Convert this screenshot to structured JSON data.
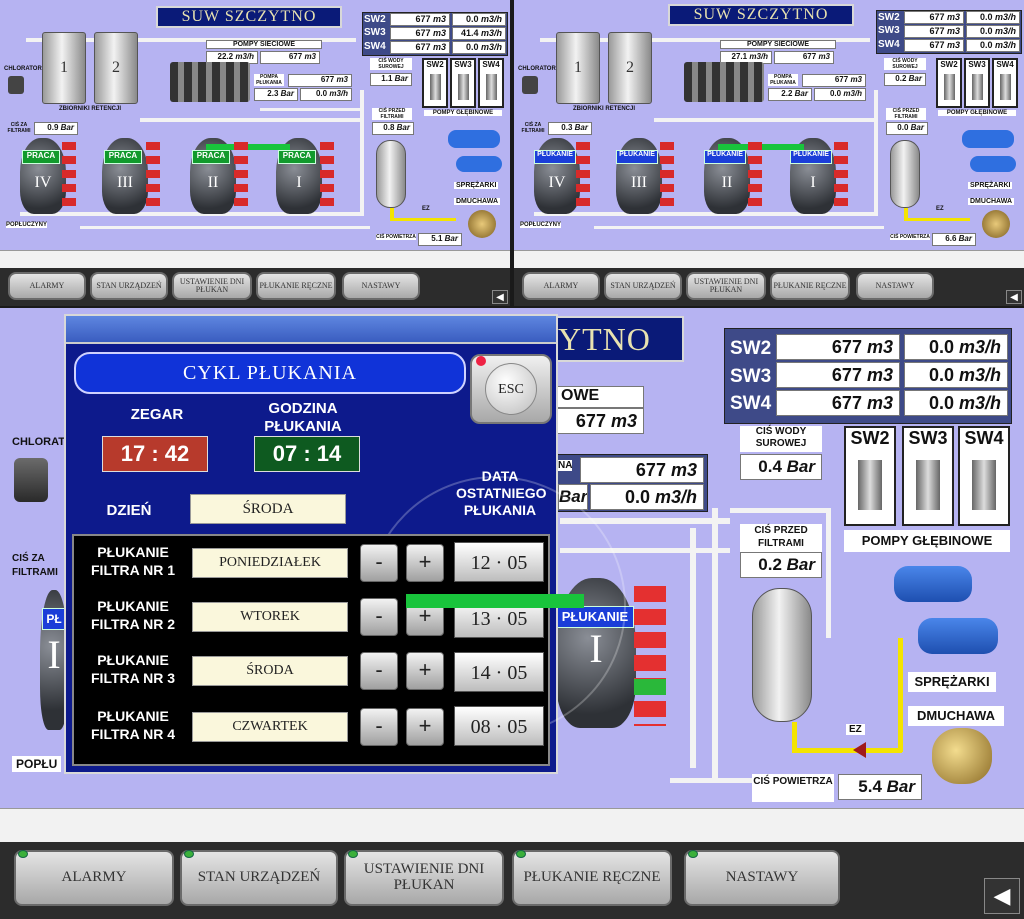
{
  "top_left": {
    "title": "SUW SZCZYTNO",
    "sw": [
      {
        "label": "SW2",
        "vol": "677",
        "vol_unit": "m3",
        "flow": "0.0",
        "flow_unit": "m3/h"
      },
      {
        "label": "SW3",
        "vol": "677",
        "vol_unit": "m3",
        "flow": "41.4",
        "flow_unit": "m3/h"
      },
      {
        "label": "SW4",
        "vol": "677",
        "vol_unit": "m3",
        "flow": "0.0",
        "flow_unit": "m3/h"
      }
    ],
    "pompy_sieciowe_label": "POMPY SIECIOWE",
    "pompy_flow": "22.2",
    "pompy_flow_unit": "m3/h",
    "pompy_vol": "677",
    "pompy_vol_unit": "m3",
    "pompa_plukania_label": "POMPA PŁUKANIA",
    "pompa_plukania_vol": "677",
    "pompa_plukania_vol_unit": "m3",
    "pompa_plukania_pressure": "2.3",
    "pompa_plukania_pressure_unit": "Bar",
    "pompa_plukania_flow": "0.0",
    "pompa_plukania_flow_unit": "m3/h",
    "cisn_wody_label": "CIŚ WODY SUROWEJ",
    "cisn_wody": "1.1",
    "cisn_wody_unit": "Bar",
    "chlorator": "CHLORATOR",
    "zbiorniki": "ZBIORNIKI RETENCJI",
    "tank1": "1",
    "tank2": "2",
    "cis_za_filtr_label": "CIŚ ZA FILTRAMI",
    "cis_za_filtr": "0.9",
    "cis_za_filtr_unit": "Bar",
    "cis_przed_label": "CIŚ PRZED FILTRAMI",
    "cis_przed": "0.8",
    "cis_przed_unit": "Bar",
    "filters": [
      "IV",
      "III",
      "II",
      "I"
    ],
    "filter_status": [
      "PRACA",
      "PRACA",
      "PRACA",
      "PRACA"
    ],
    "pompy_glebinowe": "POMPY GŁĘBINOWE",
    "sw_pumps": [
      "SW2",
      "SW3",
      "SW4"
    ],
    "sprezarki": "SPRĘŻARKI",
    "dmuchawa": "DMUCHAWA",
    "ez": "EZ",
    "poplu": "POPŁUCZYNY",
    "cis_pow_label": "CIŚ POWIETRZA",
    "cis_pow": "5.1",
    "cis_pow_unit": "Bar"
  },
  "top_right": {
    "title": "SUW SZCZYTNO",
    "sw": [
      {
        "label": "SW2",
        "vol": "677",
        "vol_unit": "m3",
        "flow": "0.0",
        "flow_unit": "m3/h"
      },
      {
        "label": "SW3",
        "vol": "677",
        "vol_unit": "m3",
        "flow": "0.0",
        "flow_unit": "m3/h"
      },
      {
        "label": "SW4",
        "vol": "677",
        "vol_unit": "m3",
        "flow": "0.0",
        "flow_unit": "m3/h"
      }
    ],
    "pompy_sieciowe_label": "POMPY SIECIOWE",
    "pompy_flow": "27.1",
    "pompy_flow_unit": "m3/h",
    "pompy_vol": "677",
    "pompy_vol_unit": "m3",
    "pompa_plukania_label": "POMPA PŁUKANIA",
    "pompa_plukania_vol": "677",
    "pompa_plukania_vol_unit": "m3",
    "pompa_plukania_pressure": "2.2",
    "pompa_plukania_pressure_unit": "Bar",
    "pompa_plukania_flow": "0.0",
    "pompa_plukania_flow_unit": "m3/h",
    "cisn_wody_label": "CIŚ WODY SUROWEJ",
    "cisn_wody": "0.2",
    "cisn_wody_unit": "Bar",
    "chlorator": "CHLORATOR",
    "zbiorniki": "ZBIORNIKI RETENCJI",
    "tank1": "1",
    "tank2": "2",
    "cis_za_filtr_label": "CIŚ ZA FILTRAMI",
    "cis_za_filtr": "0.3",
    "cis_za_filtr_unit": "Bar",
    "cis_przed_label": "CIŚ PRZED FILTRAMI",
    "cis_przed": "0.0",
    "cis_przed_unit": "Bar",
    "filters": [
      "IV",
      "III",
      "II",
      "I"
    ],
    "filter_status": [
      "PŁUKANIE",
      "PŁUKANIE",
      "PŁUKANIE",
      "PŁUKANIE"
    ],
    "pompy_glebinowe": "POMPY GŁĘBINOWE",
    "sw_pumps": [
      "SW2",
      "SW3",
      "SW4"
    ],
    "sprezarki": "SPRĘŻARKI",
    "dmuchawa": "DMUCHAWA",
    "ez": "EZ",
    "poplu": "POPŁUCZYNY",
    "cis_pow_label": "CIŚ POWIETRZA",
    "cis_pow": "6.6",
    "cis_pow_unit": "Bar"
  },
  "buttons": [
    "ALARMY",
    "STAN URZĄDZEŃ",
    "USTAWIENIE DNI PŁUKAN",
    "PŁUKANIE RĘCZNE",
    "NASTAWY"
  ],
  "return_icon": "arrow-left-icon",
  "main": {
    "title_fragment": "YTNO",
    "sw": [
      {
        "label": "SW2",
        "vol": "677",
        "vol_unit": "m3",
        "flow": "0.0",
        "flow_unit": "m3/h"
      },
      {
        "label": "SW3",
        "vol": "677",
        "vol_unit": "m3",
        "flow": "0.0",
        "flow_unit": "m3/h"
      },
      {
        "label": "SW4",
        "vol": "677",
        "vol_unit": "m3",
        "flow": "0.0",
        "flow_unit": "m3/h"
      }
    ],
    "owe_fragment": "OWE",
    "pompy_vol": "677",
    "pompy_vol_unit": "m3",
    "na_fragment": "NA",
    "pp_vol": "677",
    "pp_vol_unit": "m3",
    "bar_fragment": "Bar",
    "pp_flow": "0.0",
    "pp_flow_unit": "m3/h",
    "cisn_wody_label": "CIŚ WODY SUROWEJ",
    "cisn_wody": "0.4",
    "cisn_wody_unit": "Bar",
    "cis_przed_label": "CIŚ PRZED FILTRAMI",
    "cis_przed": "0.2",
    "cis_przed_unit": "Bar",
    "sw_pumps": [
      "SW2",
      "SW3",
      "SW4"
    ],
    "pompy_glebinowe": "POMPY GŁĘBINOWE",
    "sprezarki": "SPRĘŻARKI",
    "dmuchawa": "DMUCHAWA",
    "ez": "EZ",
    "cis_pow_label": "CIŚ POWIETRZA",
    "cis_pow": "5.4",
    "cis_pow_unit": "Bar",
    "chlorator_fragment": "CHLORAT",
    "cis_za_fragment": "CIŚ ZA FILTRAMI",
    "poplu_fragment": "POPŁU",
    "filter_label": "I",
    "filter_label_left": "I",
    "filter_status": "PŁUKANIE",
    "filter_status_left_fragment": "PŁ"
  },
  "popup": {
    "title": "CYKL PŁUKANIA",
    "esc": "ESC",
    "zegar_label": "ZEGAR",
    "godzina_label": "GODZINA PŁUKANIA",
    "zegar_time": "17 : 42",
    "godzina_time": "07 : 14",
    "dzien_label": "DZIEŃ",
    "dzien_value": "ŚRODA",
    "data_label": "DATA OSTATNIEGO PŁUKANIA",
    "filters": [
      {
        "label": "PŁUKANIE FILTRA NR 1",
        "day": "PONIEDZIAŁEK",
        "date": "12 · 05"
      },
      {
        "label": "PŁUKANIE FILTRA NR 2",
        "day": "WTOREK",
        "date": "13 · 05"
      },
      {
        "label": "PŁUKANIE FILTRA NR 3",
        "day": "ŚRODA",
        "date": "14 · 05"
      },
      {
        "label": "PŁUKANIE FILTRA NR 4",
        "day": "CZWARTEK",
        "date": "08 · 05"
      }
    ],
    "minus": "-",
    "plus": "+"
  },
  "colors": {
    "screen_bg": "#b6b3f2",
    "praca": "#119a2c",
    "plukanie": "#1b3ed8",
    "popup_bg": "#0d1a8c",
    "clock_red": "#b73a2c",
    "clock_green": "#0e5a20"
  }
}
